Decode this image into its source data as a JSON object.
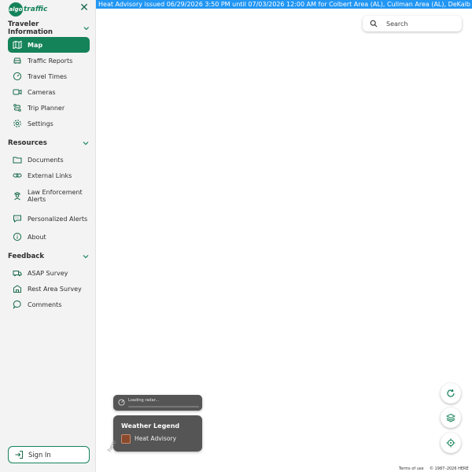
{
  "logo": {
    "mark": "algo",
    "text": "traffic"
  },
  "banner": {
    "text": "Heat Advisory issued 06/29/2026 3:50 PM until 07/03/2026 12:00 AM for Colbert Area (AL), Cullman Area (AL), DeKalb Area (AL), Fr"
  },
  "sections": {
    "traveler": "Traveler Information",
    "resources": "Resources",
    "feedback": "Feedback"
  },
  "traveler_items": [
    {
      "label": "Map"
    },
    {
      "label": "Traffic Reports"
    },
    {
      "label": "Travel Times"
    },
    {
      "label": "Cameras"
    },
    {
      "label": "Trip Planner"
    },
    {
      "label": "Settings"
    }
  ],
  "resource_items": [
    {
      "label": "Documents"
    },
    {
      "label": "External Links"
    },
    {
      "label": "Law Enforcement Alerts"
    },
    {
      "label": "Personalized Alerts"
    },
    {
      "label": "About"
    }
  ],
  "feedback_items": [
    {
      "label": "ASAP Survey"
    },
    {
      "label": "Rest Area Survey"
    },
    {
      "label": "Comments"
    }
  ],
  "signin": {
    "label": "Sign In"
  },
  "search": {
    "placeholder": "Search"
  },
  "radar": {
    "text": "Loading radar..."
  },
  "legend": {
    "title": "Weather Legend",
    "items": [
      {
        "label": "Heat Advisory",
        "color": "#8a4a2e"
      }
    ]
  },
  "map_attribution": {
    "provider": "here",
    "terms": "Terms of use",
    "copyright": "© 1987–2026 HERE"
  },
  "colors": {
    "brand": "#15835a",
    "banner": "#2196f3"
  }
}
